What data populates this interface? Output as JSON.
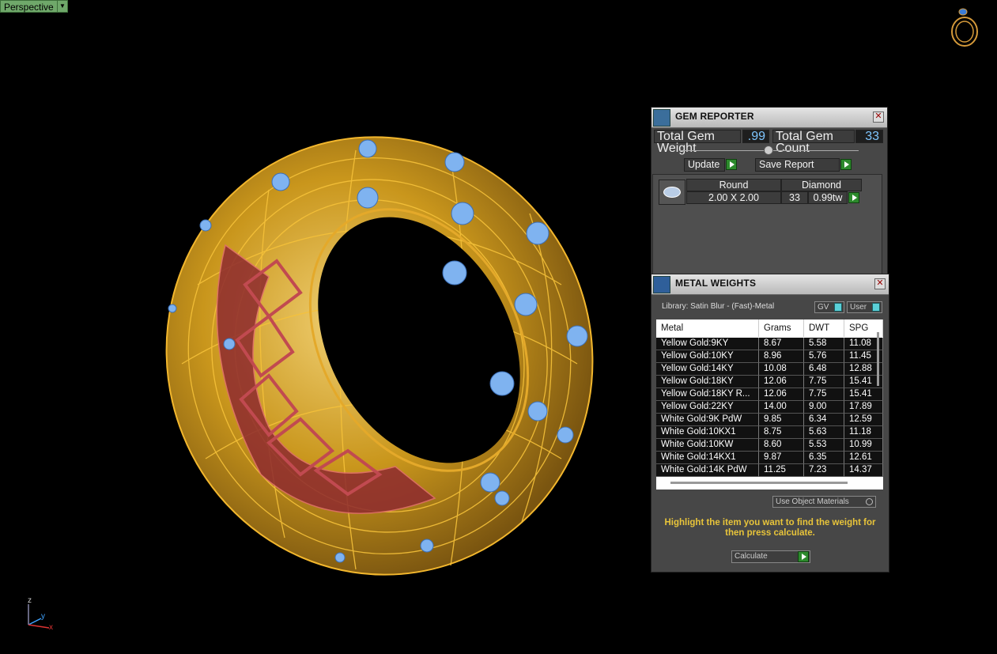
{
  "viewport": {
    "view_name": "Perspective",
    "axis_z": "z",
    "axis_y": "y",
    "axis_x": "x"
  },
  "gem_reporter": {
    "title": "GEM REPORTER",
    "total_weight_label": "Total Gem Weight",
    "total_weight_value": ".99",
    "total_count_label": "Total Gem Count",
    "total_count_value": "33",
    "update_label": "Update",
    "save_report_label": "Save Report",
    "gem": {
      "shape": "Round",
      "size": "2.00 X 2.00",
      "material": "Diamond",
      "count": "33",
      "weight": "0.99tw"
    }
  },
  "metal_weights": {
    "title": "METAL WEIGHTS",
    "library": "Library: Satin Blur - (Fast)-Metal",
    "gv_label": "GV",
    "user_label": "User",
    "columns": [
      "Metal",
      "Grams",
      "DWT",
      "SPG"
    ],
    "rows": [
      [
        "Yellow Gold:9KY",
        "8.67",
        "5.58",
        "11.08"
      ],
      [
        "Yellow Gold:10KY",
        "8.96",
        "5.76",
        "11.45"
      ],
      [
        "Yellow Gold:14KY",
        "10.08",
        "6.48",
        "12.88"
      ],
      [
        "Yellow Gold:18KY",
        "12.06",
        "7.75",
        "15.41"
      ],
      [
        "Yellow Gold:18KY R...",
        "12.06",
        "7.75",
        "15.41"
      ],
      [
        "Yellow Gold:22KY",
        "14.00",
        "9.00",
        "17.89"
      ],
      [
        "White Gold:9K PdW",
        "9.85",
        "6.34",
        "12.59"
      ],
      [
        "White Gold:10KX1",
        "8.75",
        "5.63",
        "11.18"
      ],
      [
        "White Gold:10KW",
        "8.60",
        "5.53",
        "10.99"
      ],
      [
        "White Gold:14KX1",
        "9.87",
        "6.35",
        "12.61"
      ],
      [
        "White Gold:14K PdW",
        "11.25",
        "7.23",
        "14.37"
      ]
    ],
    "use_object_materials": "Use Object Materials",
    "hint": "Highlight the item you want to find the weight for then press calculate.",
    "calculate_label": "Calculate"
  },
  "colors": {
    "gold": "#c9961c",
    "gem_blue": "#7fb3f0",
    "pierced_red": "#8e2a2f",
    "panel_bg": "#474747",
    "accent_green": "#2c8a2c"
  }
}
